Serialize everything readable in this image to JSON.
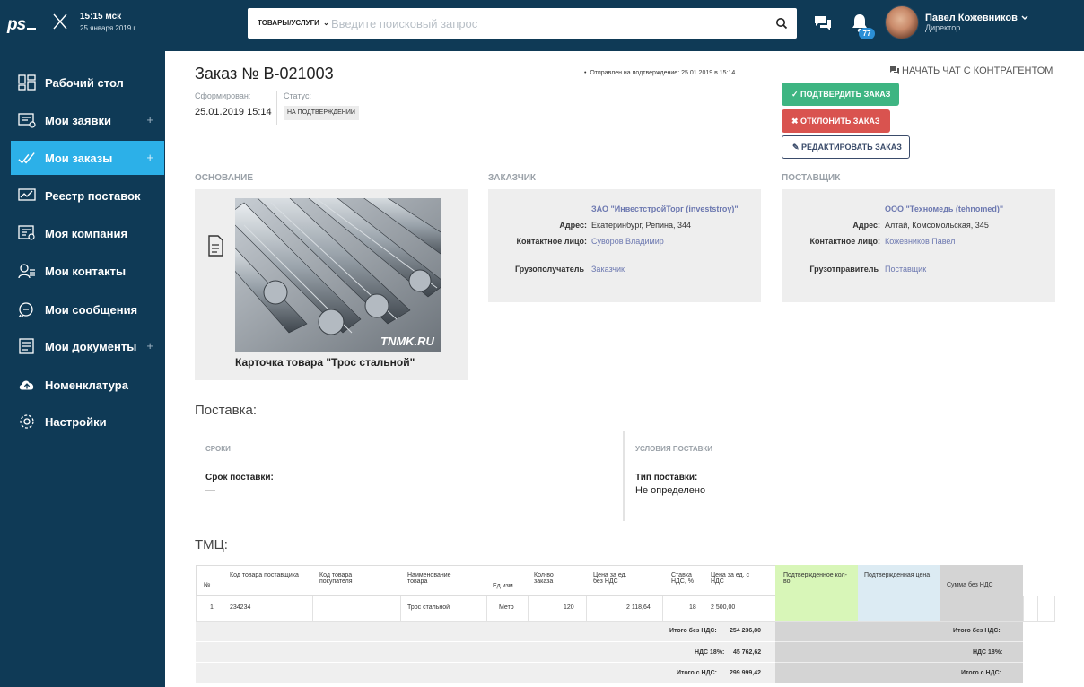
{
  "header": {
    "logo": "ps",
    "time": "15:15 мск",
    "date": "25 января 2019 г.",
    "search_category": "ТОВАРЫ/УСЛУГИ",
    "search_placeholder": "Введите поисковый запрос",
    "notifications_count": "77",
    "user_name": "Павел Кожевников",
    "user_role": "Директор"
  },
  "sidebar": {
    "items": [
      {
        "label": "Рабочий стол",
        "icon": "dashboard-icon"
      },
      {
        "label": "Мои заявки",
        "icon": "requests-icon",
        "plus": "+"
      },
      {
        "label": "Мои заказы",
        "icon": "orders-icon",
        "plus": "+",
        "active": true
      },
      {
        "label": "Реестр поставок",
        "icon": "registry-icon"
      },
      {
        "label": "Моя компания",
        "icon": "company-icon"
      },
      {
        "label": "Мои контакты",
        "icon": "contacts-icon"
      },
      {
        "label": "Мои сообщения",
        "icon": "messages-icon"
      },
      {
        "label": "Мои документы",
        "icon": "documents-icon",
        "plus": "+"
      },
      {
        "label": "Номенклатура",
        "icon": "cloud-upload-icon"
      },
      {
        "label": "Настройки",
        "icon": "settings-icon"
      }
    ]
  },
  "order": {
    "title": "Заказ № В-021003",
    "formed_label": "Сформирован:",
    "formed_value": "25.01.2019 15:14",
    "status_label": "Статус:",
    "status_value": "НА ПОДТВЕРЖДЕНИИ",
    "sent_note": "Отправлен на подтверждение: 25.01.2019 в 15:14",
    "chat_link": "НАЧАТЬ ЧАТ С КОНТРАГЕНТОМ",
    "confirm_button": "✓ ПОДТВЕРДИТЬ ЗАКАЗ",
    "reject_button": "✖ ОТКЛОНИТЬ ЗАКАЗ",
    "edit_button": "✎ РЕДАКТИРОВАТЬ ЗАКАЗ"
  },
  "basis": {
    "heading": "ОСНОВАНИЕ",
    "watermark": "TNMK.RU",
    "caption": "Карточка товара \"Трос стальной\""
  },
  "customer": {
    "heading": "ЗАКАЗЧИК",
    "name": "ЗАО \"ИнвестстройТорг (investstroy)\"",
    "address_label": "Адрес:",
    "address": "Екатеринбург, Репина, 344",
    "contact_label": "Контактное лицо:",
    "contact": "Суворов Владимир",
    "consignee_label": "Грузополучатель",
    "consignee": "Заказчик"
  },
  "supplier": {
    "heading": "ПОСТАВЩИК",
    "name": "ООО \"Техномедь (tehnomed)\"",
    "address_label": "Адрес:",
    "address": "Алтай, Комсомольская, 345",
    "contact_label": "Контактное лицо:",
    "contact": "Кожевников Павел",
    "shipper_label": "Грузотправитель",
    "shipper": "Поставщик"
  },
  "delivery": {
    "heading": "Поставка:",
    "terms_head": "СРОКИ",
    "term_label": "Срок поставки:",
    "term_value": "—",
    "conditions_head": "УСЛОВИЯ ПОСТАВКИ",
    "type_label": "Тип поставки:",
    "type_value": "Не определено"
  },
  "goods": {
    "heading": "ТМЦ:",
    "columns": [
      "№",
      "Код товара поставщика",
      "Код товара покупателя",
      "Наименование товара",
      "Ед.изм.",
      "Кол-во заказа",
      "Цена за ед. без НДС",
      "Ставка НДС, %",
      "Цена за ед. с НДС",
      "Подтвержденное кол-во",
      "Подтвержденная цена",
      "Сумма без НДС"
    ],
    "rows": [
      {
        "n": "1",
        "supplier_code": "234234",
        "buyer_code": "",
        "name": "Трос стальной",
        "unit": "Метр",
        "qty": "120",
        "price": "2 118,64",
        "vat": "18",
        "price_vat": "2 500,00"
      }
    ],
    "totals": {
      "net_label": "Итого без НДС:",
      "net_value": "254 236,80",
      "vat_label": "НДС 18%:",
      "vat_value": "45 762,62",
      "gross_label": "Итого с НДС:",
      "gross_value": "299 999,42",
      "net_label_right": "Итого без НДС:",
      "vat_label_right": "НДС 18%:",
      "gross_label_right": "Итого с НДС:"
    }
  }
}
